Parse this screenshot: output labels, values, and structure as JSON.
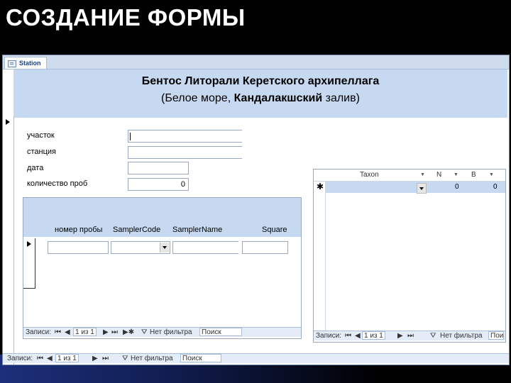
{
  "slide": {
    "title": "СОЗДАНИЕ ФОРМЫ"
  },
  "tab": {
    "label": "Station"
  },
  "header": {
    "line1": "Бентос Литорали Керетского архипеллага",
    "line2_open": "(Белое море, ",
    "line2_middle": "Кандалакшский",
    "line2_close": " залив)"
  },
  "fields": [
    {
      "label": "участок",
      "value": ""
    },
    {
      "label": "станция",
      "value": ""
    },
    {
      "label": "дата",
      "value": ""
    },
    {
      "label": "количество проб",
      "value": "0"
    }
  ],
  "subform": {
    "columns": [
      "номер пробы",
      "SamplerCode",
      "SamplerName",
      "Square"
    ],
    "nav": {
      "records_label": "Записи:",
      "position": "1 из 1",
      "filter": "Нет фильтра",
      "search": "Поиск"
    }
  },
  "datasheet": {
    "columns": [
      "Taxon",
      "N",
      "B"
    ],
    "new_row": {
      "marker": "✱",
      "taxon": "",
      "n": "0",
      "b": "0"
    },
    "nav": {
      "records_label": "Записи:",
      "position": "1 из 1",
      "filter": "Нет фильтра",
      "search": "Поиск"
    }
  },
  "main_nav": {
    "records_label": "Записи:",
    "position": "1 из 1",
    "filter": "Нет фильтра",
    "search": "Поиск"
  }
}
